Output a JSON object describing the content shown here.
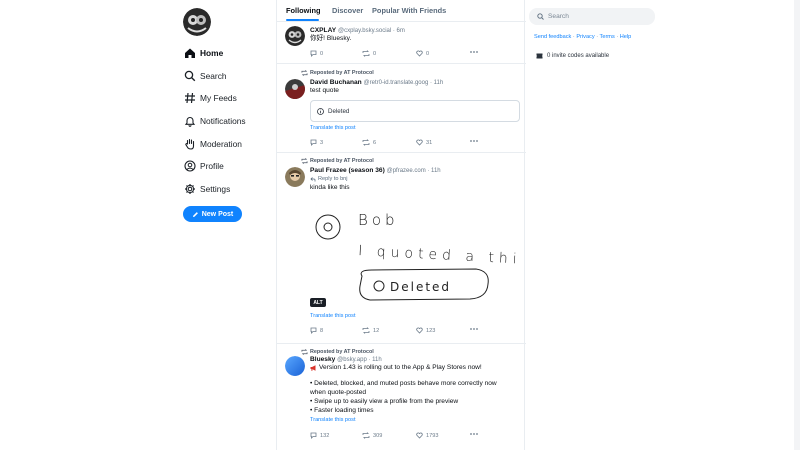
{
  "sidebar": {
    "items": [
      {
        "label": "Home",
        "icon": "home-icon",
        "active": true
      },
      {
        "label": "Search",
        "icon": "search-icon"
      },
      {
        "label": "My Feeds",
        "icon": "hashtag-icon"
      },
      {
        "label": "Notifications",
        "icon": "bell-icon"
      },
      {
        "label": "Moderation",
        "icon": "hand-icon"
      },
      {
        "label": "Profile",
        "icon": "user-icon"
      },
      {
        "label": "Settings",
        "icon": "gear-icon"
      }
    ],
    "new_post": "New Post"
  },
  "tabs": [
    "Following",
    "Discover",
    "Popular With Friends"
  ],
  "posts": [
    {
      "name": "CXPLAY",
      "meta": "@cxplay.bsky.social · 6m",
      "text": "你好! Bluesky.",
      "counts": {
        "reply": "0",
        "repost": "0",
        "like": "0"
      }
    },
    {
      "repost_label": "Reposted by AT Protocol",
      "name": "David Buchanan",
      "meta": "@retr0-id.translate.goog · 11h",
      "text": "test quote",
      "quote": "Deleted",
      "translate": "Translate this post",
      "counts": {
        "reply": "3",
        "repost": "6",
        "like": "31"
      }
    },
    {
      "repost_label": "Reposted by AT Protocol",
      "name": "Paul Frazee (season 36)",
      "meta": "@pfrazee.com · 11h",
      "reply_to": "Reply to bnj",
      "text": "kinda like this",
      "drawing_text": {
        "line1": "Bob",
        "line2": "I quoted a thing",
        "line3": "Deleted"
      },
      "alt": "ALT",
      "translate": "Translate this post",
      "counts": {
        "reply": "8",
        "repost": "12",
        "like": "123"
      }
    },
    {
      "repost_label": "Reposted by AT Protocol",
      "name": "Bluesky",
      "meta": "@bsky.app · 11h",
      "lines": [
        "Version 1.43 is rolling out to the App & Play Stores now!",
        "• Deleted, blocked, and muted posts behave more correctly now",
        "when quote-posted",
        "• Swipe up to easily view a profile from the preview",
        "• Faster loading times"
      ],
      "translate": "Translate this post",
      "counts": {
        "reply": "132",
        "repost": "309",
        "like": "1793"
      }
    }
  ],
  "right": {
    "search_placeholder": "Search",
    "links": [
      "Send feedback",
      "Privacy",
      "Terms",
      "Help"
    ],
    "link_sep": " · ",
    "invite": "0 invite codes available"
  },
  "colors": {
    "accent": "#1083fe",
    "border": "#e9edf1"
  }
}
